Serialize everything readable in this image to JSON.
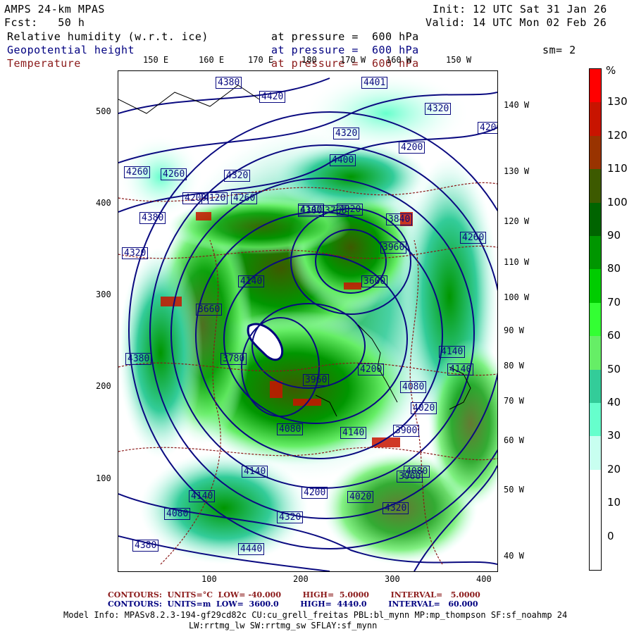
{
  "header": {
    "model": "AMPS 24-km MPAS",
    "init": "Init: 12 UTC Sat 31 Jan 26",
    "fcst": "Fcst:   50 h",
    "valid": "Valid: 14 UTC Mon 02 Feb 26",
    "field1": "Relative humidity (w.r.t. ice)",
    "field2": "Geopotential height",
    "field3": "Temperature",
    "pressure1": "at pressure =  600 hPa",
    "pressure2": "at pressure =  600 hPa",
    "pressure3": "at pressure =  600 hPa",
    "smoothing": "sm= 2"
  },
  "axes": {
    "y_ticks": [
      "500",
      "400",
      "300",
      "200",
      "100"
    ],
    "x_ticks": [
      "100",
      "200",
      "300",
      "400"
    ],
    "lon_top": [
      "150 E",
      "160 E",
      "170 E",
      "180",
      "170 W",
      "160 W",
      "150 W"
    ],
    "lon_right": [
      "140 W",
      "130 W",
      "120 W",
      "110 W",
      "100 W",
      "90 W",
      "80 W",
      "70 W",
      "60 W",
      "50 W",
      "40 W"
    ]
  },
  "colorbar": {
    "unit": "%",
    "labels": [
      "130",
      "120",
      "110",
      "100",
      "90",
      "80",
      "70",
      "60",
      "50",
      "40",
      "30",
      "20",
      "10",
      "0"
    ],
    "colors": [
      "#ff0000",
      "#c81400",
      "#993300",
      "#3d5a00",
      "#006400",
      "#009600",
      "#00cc00",
      "#33ff33",
      "#66ee66",
      "#33cc99",
      "#66ffcc",
      "#c8fff0",
      "#ffffff",
      "#ffffff",
      "#ffffff"
    ]
  },
  "height_labels": [
    "4380",
    "4401",
    "4420",
    "4320",
    "4320",
    "4200",
    "4400",
    "4200",
    "4260",
    "4320",
    "4260",
    "4380",
    "4120",
    "4380",
    "4200",
    "4260",
    "4140",
    "4020",
    "3960",
    "3840",
    "3760",
    "4260",
    "4320",
    "4140",
    "3660",
    "3600",
    "3780",
    "3960",
    "4200",
    "4020",
    "4140",
    "4080",
    "3900",
    "4080",
    "4140",
    "4140",
    "3960",
    "4020",
    "4080",
    "4320",
    "4320",
    "4380",
    "4440",
    "4380",
    "4080",
    "4140",
    "4200",
    "4140"
  ],
  "footer": {
    "temp_contours": "CONTOURS:  UNITS=°C  LOW= -40.000        HIGH=  5.0000        INTERVAL=   5.0000",
    "height_contours": "CONTOURS:  UNITS=m  LOW=  3600.0        HIGH=  4440.0        INTERVAL=   60.000",
    "model_info_1": "Model Info: MPASv8.2.3-194-gf29cd82c CU:cu_grell_freitas PBL:bl_mynn MP:mp_thompson SF:sf_noahmp 24",
    "model_info_2": "LW:rrtmg_lw SW:rrtmg_sw SFLAY:sf_mynn"
  }
}
